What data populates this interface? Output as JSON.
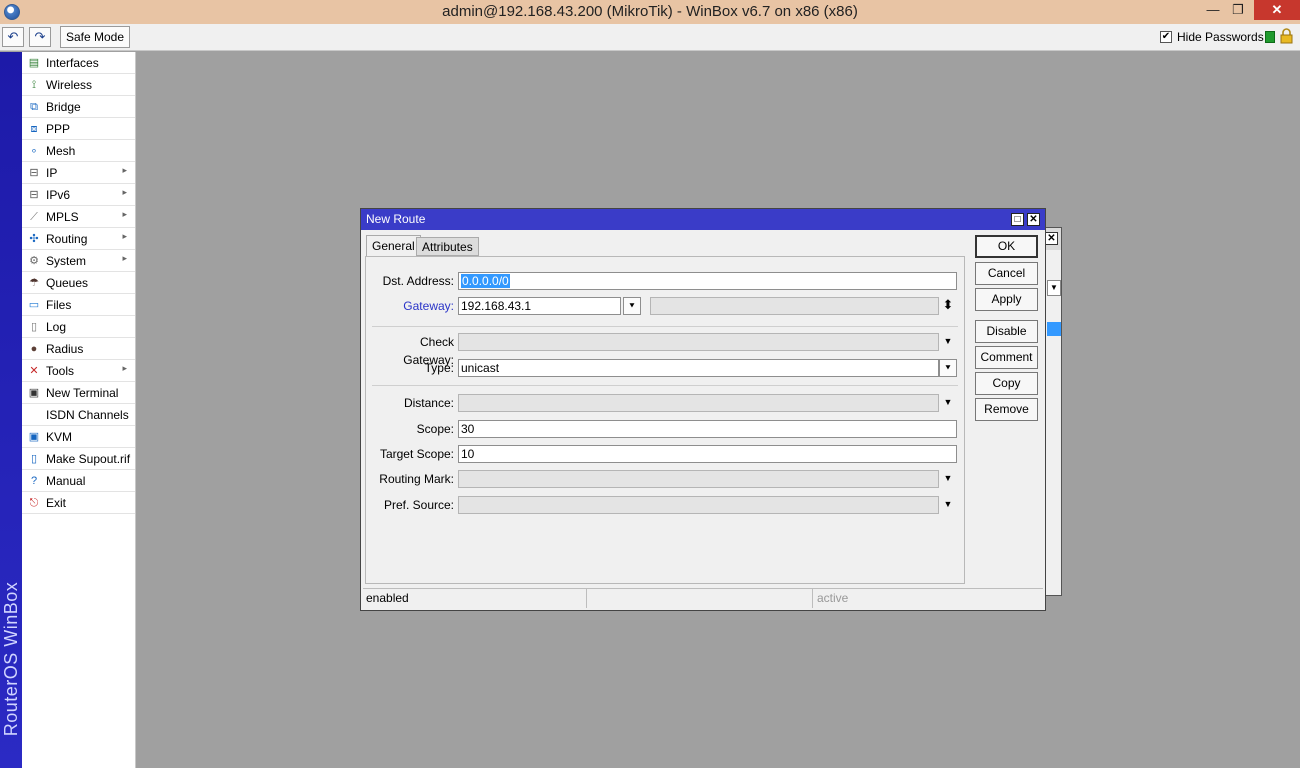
{
  "window": {
    "title": "admin@192.168.43.200 (MikroTik) - WinBox v6.7 on x86 (x86)",
    "min_glyph": "—",
    "max_glyph": "❐",
    "close_glyph": "✕"
  },
  "toolbar": {
    "undo_glyph": "↶",
    "redo_glyph": "↷",
    "safe_mode_label": "Safe Mode",
    "hide_passwords_label": "Hide Passwords",
    "hide_passwords_checked": "✔"
  },
  "strip": {
    "brand": "RouterOS WinBox"
  },
  "menu": {
    "items": [
      {
        "label": "Interfaces",
        "icon": "interfaces-icon",
        "glyph": "▤",
        "color": "#2e7d32",
        "submenu": false
      },
      {
        "label": "Wireless",
        "icon": "wireless-icon",
        "glyph": "⟟",
        "color": "#2e7d32",
        "submenu": false
      },
      {
        "label": "Bridge",
        "icon": "bridge-icon",
        "glyph": "⧉",
        "color": "#1565c0",
        "submenu": false
      },
      {
        "label": "PPP",
        "icon": "ppp-icon",
        "glyph": "⧈",
        "color": "#1565c0",
        "submenu": false
      },
      {
        "label": "Mesh",
        "icon": "mesh-icon",
        "glyph": "∘",
        "color": "#1565c0",
        "submenu": false
      },
      {
        "label": "IP",
        "icon": "ip-icon",
        "glyph": "⊟",
        "color": "#555555",
        "submenu": true
      },
      {
        "label": "IPv6",
        "icon": "ipv6-icon",
        "glyph": "⊟",
        "color": "#555555",
        "submenu": true
      },
      {
        "label": "MPLS",
        "icon": "mpls-icon",
        "glyph": "⟋",
        "color": "#777777",
        "submenu": true
      },
      {
        "label": "Routing",
        "icon": "routing-icon",
        "glyph": "✣",
        "color": "#1565c0",
        "submenu": true
      },
      {
        "label": "System",
        "icon": "system-icon",
        "glyph": "⚙",
        "color": "#666666",
        "submenu": true
      },
      {
        "label": "Queues",
        "icon": "queues-icon",
        "glyph": "☂",
        "color": "#4e342e",
        "submenu": false
      },
      {
        "label": "Files",
        "icon": "files-icon",
        "glyph": "▭",
        "color": "#1976d2",
        "submenu": false
      },
      {
        "label": "Log",
        "icon": "log-icon",
        "glyph": "▯",
        "color": "#777777",
        "submenu": false
      },
      {
        "label": "Radius",
        "icon": "radius-icon",
        "glyph": "●",
        "color": "#5d4037",
        "submenu": false
      },
      {
        "label": "Tools",
        "icon": "tools-icon",
        "glyph": "✕",
        "color": "#c62828",
        "submenu": true
      },
      {
        "label": "New Terminal",
        "icon": "terminal-icon",
        "glyph": "▣",
        "color": "#333333",
        "submenu": false
      },
      {
        "label": "ISDN Channels",
        "icon": "",
        "glyph": "",
        "color": "#000000",
        "submenu": false
      },
      {
        "label": "KVM",
        "icon": "kvm-icon",
        "glyph": "▣",
        "color": "#1565c0",
        "submenu": false
      },
      {
        "label": "Make Supout.rif",
        "icon": "supout-icon",
        "glyph": "▯",
        "color": "#1565c0",
        "submenu": false
      },
      {
        "label": "Manual",
        "icon": "manual-icon",
        "glyph": "?",
        "color": "#1565c0",
        "submenu": false
      },
      {
        "label": "Exit",
        "icon": "exit-icon",
        "glyph": "⎋",
        "color": "#c62828",
        "submenu": false
      }
    ],
    "submenu_glyph": "▸"
  },
  "dialog": {
    "title": "New Route",
    "max_glyph": "□",
    "close_glyph": "✕",
    "tabs": [
      "General",
      "Attributes"
    ],
    "fields": {
      "dst_address": {
        "label": "Dst. Address:",
        "value": "0.0.0.0/0"
      },
      "gateway": {
        "label": "Gateway:",
        "value": "192.168.43.1",
        "extra_value": ""
      },
      "check_gateway": {
        "label": "Check Gateway:",
        "value": ""
      },
      "type": {
        "label": "Type:",
        "value": "unicast"
      },
      "distance": {
        "label": "Distance:",
        "value": ""
      },
      "scope": {
        "label": "Scope:",
        "value": "30"
      },
      "target_scope": {
        "label": "Target Scope:",
        "value": "10"
      },
      "routing_mark": {
        "label": "Routing Mark:",
        "value": ""
      },
      "pref_source": {
        "label": "Pref. Source:",
        "value": ""
      }
    },
    "glyphs": {
      "dropdown": "▼",
      "dropdown_boxed": "⯆",
      "updown": "⬍"
    },
    "buttons": {
      "ok": "OK",
      "cancel": "Cancel",
      "apply": "Apply",
      "disable": "Disable",
      "comment": "Comment",
      "copy": "Copy",
      "remove": "Remove"
    },
    "status": {
      "state": "enabled",
      "middle": "",
      "active": "active"
    }
  },
  "background_window": {
    "close_glyph": "✕",
    "dropdown_glyph": "▼"
  },
  "colors": {
    "title_bar": "#e8c4a4",
    "dialog_title": "#3a3cc8",
    "strip": "#2b2ac4",
    "selection": "#3399ff",
    "gateway_label": "#2a34c8"
  }
}
